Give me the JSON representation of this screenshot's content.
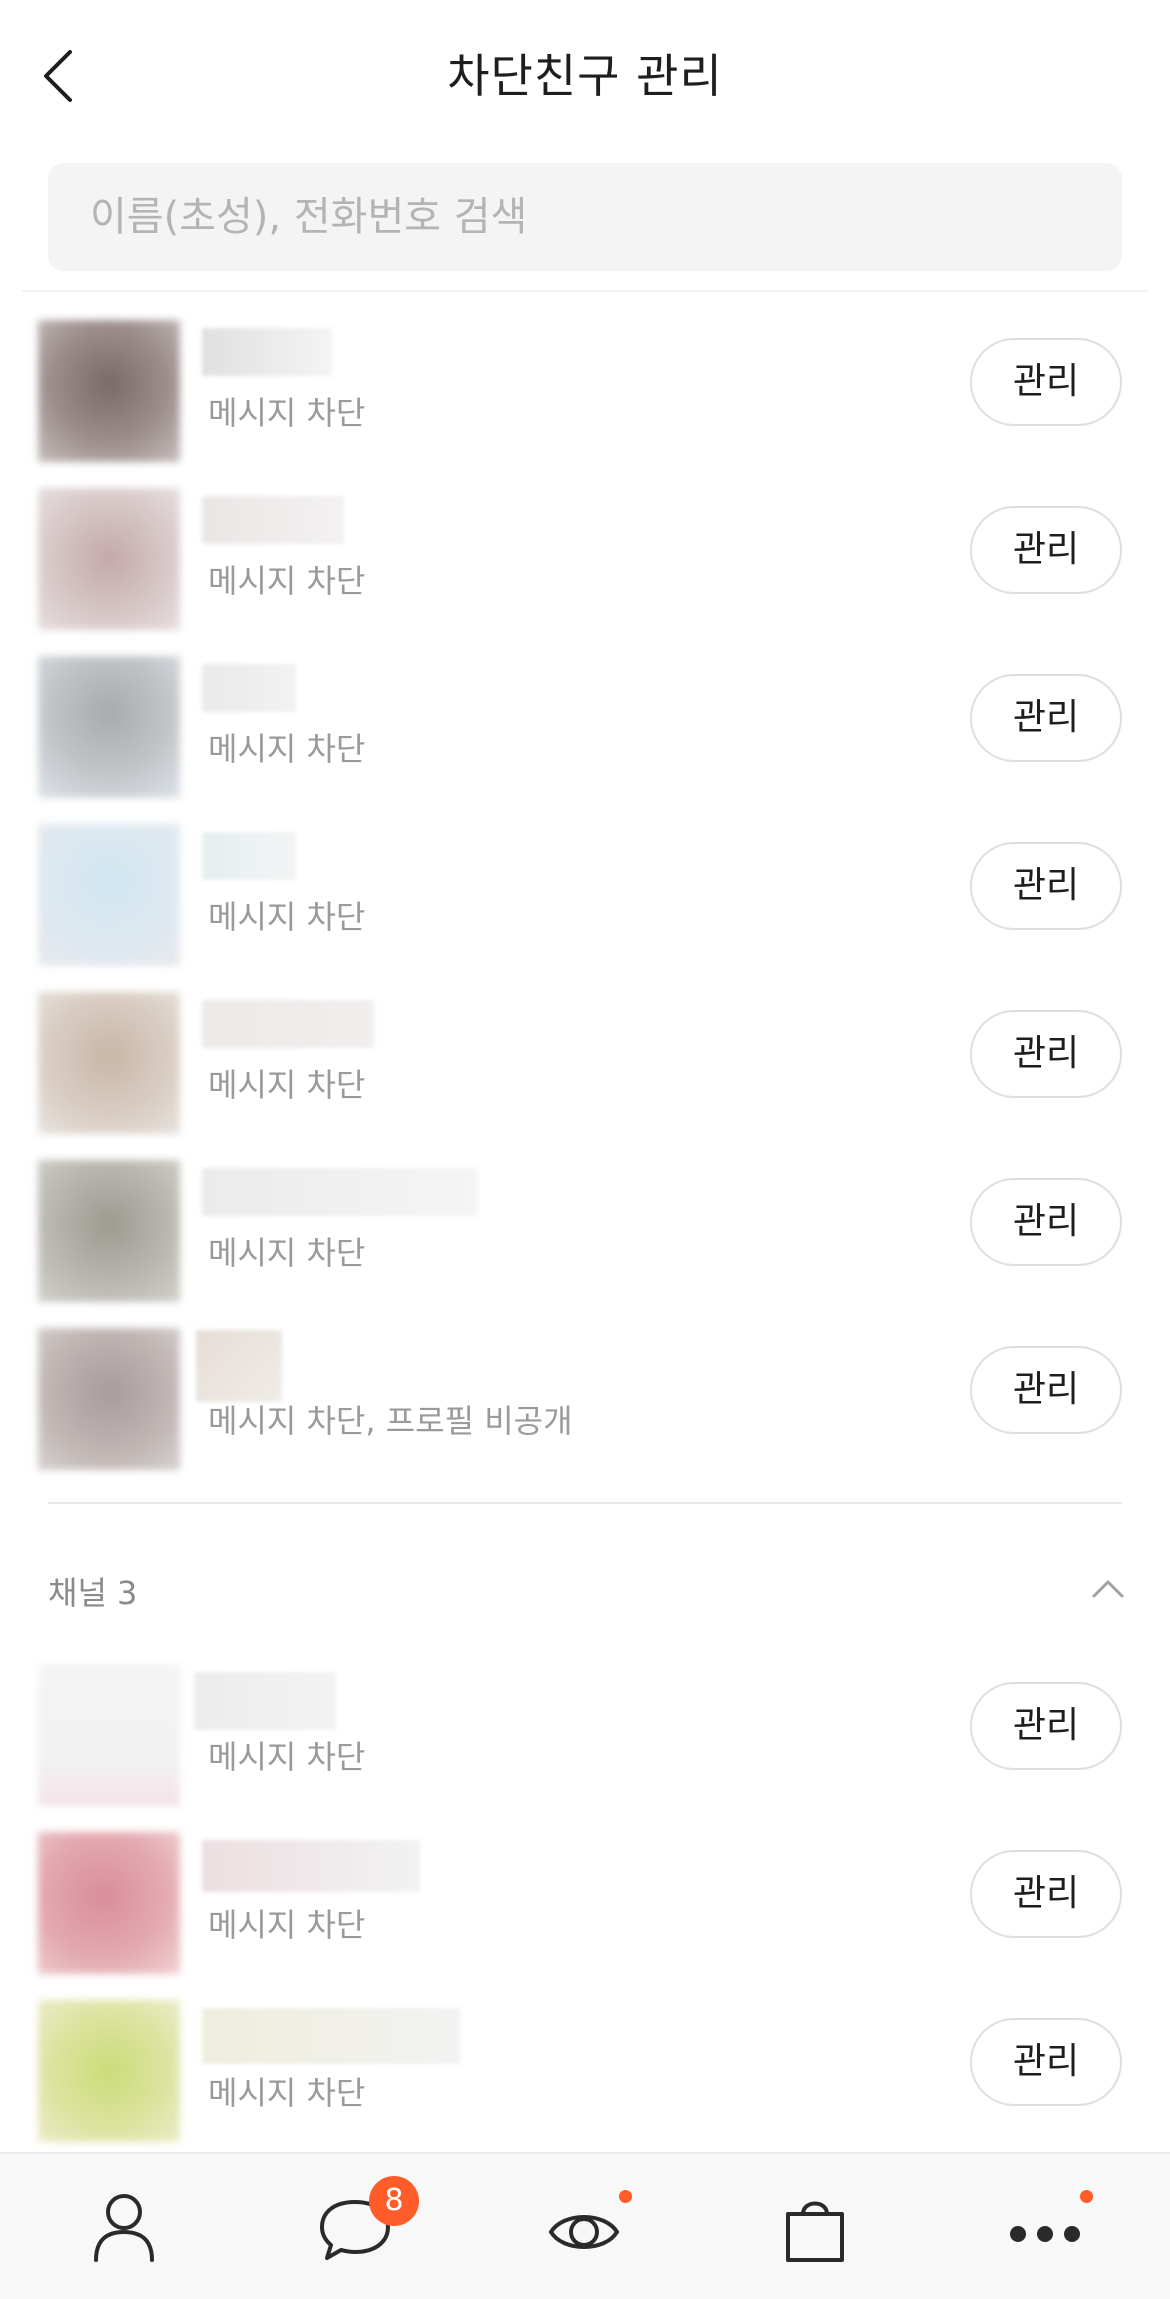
{
  "header": {
    "title": "차단친구 관리"
  },
  "search": {
    "placeholder": "이름(초성), 전화번호 검색"
  },
  "friends": [
    {
      "status": "메시지 차단",
      "manage_label": "관리"
    },
    {
      "status": "메시지 차단",
      "manage_label": "관리"
    },
    {
      "status": "메시지 차단",
      "manage_label": "관리"
    },
    {
      "status": "메시지 차단",
      "manage_label": "관리"
    },
    {
      "status": "메시지 차단",
      "manage_label": "관리"
    },
    {
      "status": "메시지 차단",
      "manage_label": "관리"
    },
    {
      "status": "메시지 차단, 프로필 비공개",
      "manage_label": "관리"
    }
  ],
  "channels": {
    "title": "채널 3",
    "items": [
      {
        "status": "메시지 차단",
        "manage_label": "관리"
      },
      {
        "status": "메시지 차단",
        "manage_label": "관리"
      },
      {
        "status": "메시지 차단",
        "manage_label": "관리"
      }
    ]
  },
  "tabbar": {
    "tabs": [
      "person-icon",
      "chat-bubble-icon",
      "eye-icon",
      "shopping-bag-icon",
      "more-dots-icon"
    ],
    "chat_badge": "8"
  },
  "colors": {
    "accent": "#ff5c2a",
    "muted_text": "#9a9a9a",
    "search_bg": "#f4f4f4"
  }
}
